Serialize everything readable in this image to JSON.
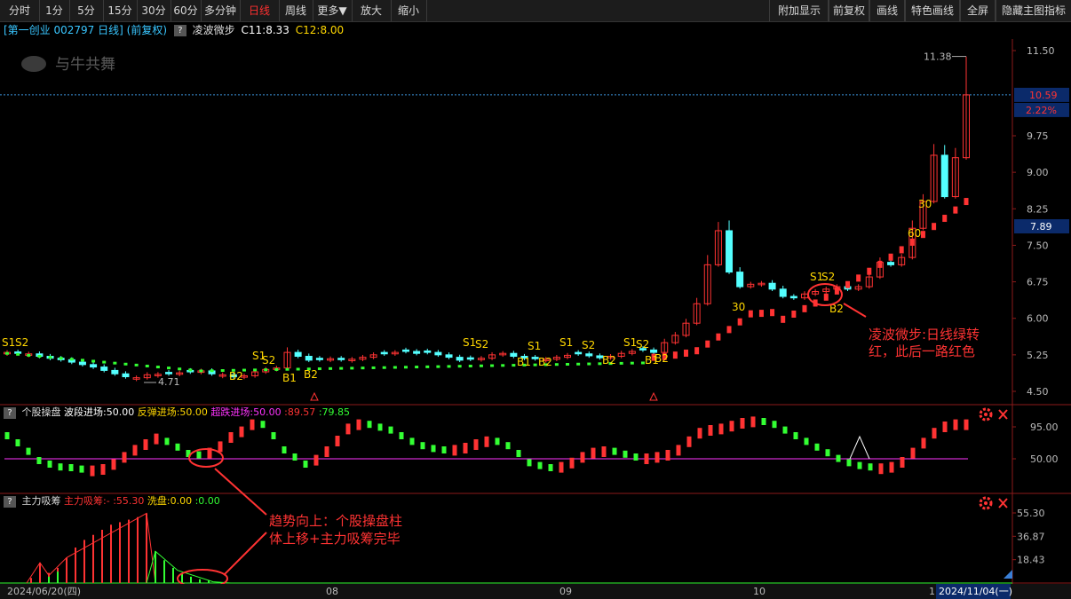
{
  "toolbar": {
    "left": [
      "分时",
      "1分",
      "5分",
      "15分",
      "30分",
      "60分",
      "多分钟",
      "日线",
      "周线",
      "更多▼",
      "放大",
      "缩小"
    ],
    "active": "日线",
    "right": [
      "附加显示",
      "前复权",
      "画线",
      "特色画线",
      "全屏",
      "隐藏主图指标"
    ]
  },
  "main_title": {
    "stock": "[第一创业 002797 日线]",
    "adjust": "(前复权)",
    "indicator": "凌波微步",
    "c11": "C11:8.33",
    "c12": "C12:8.00"
  },
  "watermark": "与牛共舞",
  "price_axis": {
    "ticks": [
      "11.50",
      "10.59",
      "9.75",
      "9.00",
      "8.25",
      "7.89",
      "7.50",
      "6.75",
      "6.00",
      "5.25",
      "4.50"
    ],
    "current": "10.59",
    "pct": "2.22%",
    "marker": "7.89"
  },
  "annotations": {
    "high": "11.38",
    "low": "4.71",
    "note1": "凌波微步:日线绿转\n红，此后一路红色",
    "note2": "趋势向上：个股操盘柱\n体上移+主力吸筹完毕"
  },
  "panel1": {
    "name": "个股操盘",
    "l1": "波段进场:50.00",
    "l2": "反弹进场:50.00",
    "l3": "超跌进场:50.00",
    "v1": ":89.57",
    "v2": ":79.85",
    "ticks": [
      "95.00",
      "50.00"
    ]
  },
  "panel2": {
    "name": "主力吸筹",
    "l1": "主力吸筹:-",
    "v1": ":55.30",
    "l2": "洗盘:0.00",
    "v2": ":0.00",
    "ticks": [
      "55.30",
      "36.87",
      "18.43"
    ]
  },
  "date_axis": {
    "start": "2024/06/20(四)",
    "m1": "08",
    "m2": "09",
    "m3": "10",
    "m4": "1",
    "end": "2024/11/04(一)"
  },
  "signals": [
    "S1",
    "S2",
    "B1",
    "B2",
    "30",
    "60"
  ],
  "colors": {
    "up": "#ff3333",
    "down": "#54ffff",
    "sig": "#ffd700",
    "magenta": "#ff33ff",
    "green": "#33ff33"
  },
  "chart_data": {
    "type": "candlestick",
    "y_range": [
      4.5,
      11.5
    ],
    "closes": [
      5.3,
      5.28,
      5.27,
      5.22,
      5.18,
      5.15,
      5.1,
      5.05,
      5.0,
      4.93,
      4.86,
      4.8,
      4.78,
      4.84,
      4.85,
      4.86,
      4.88,
      4.9,
      4.92,
      4.86,
      4.84,
      4.8,
      4.82,
      4.9,
      4.95,
      4.98,
      5.3,
      5.22,
      5.14,
      5.15,
      5.17,
      5.15,
      5.16,
      5.2,
      5.25,
      5.27,
      5.3,
      5.32,
      5.28,
      5.3,
      5.25,
      5.2,
      5.14,
      5.16,
      5.18,
      5.25,
      5.28,
      5.22,
      5.18,
      5.17,
      5.16,
      5.2,
      5.24,
      5.27,
      5.23,
      5.19,
      5.22,
      5.28,
      5.32,
      5.35,
      5.3,
      5.5,
      5.65,
      5.9,
      6.3,
      7.1,
      7.8,
      6.95,
      6.65,
      6.7,
      6.72,
      6.6,
      6.45,
      6.42,
      6.5,
      6.55,
      6.6,
      6.65,
      6.6,
      6.65,
      6.85,
      7.15,
      7.1,
      7.25,
      7.85,
      8.4,
      9.35,
      8.5,
      9.3,
      10.59
    ]
  }
}
